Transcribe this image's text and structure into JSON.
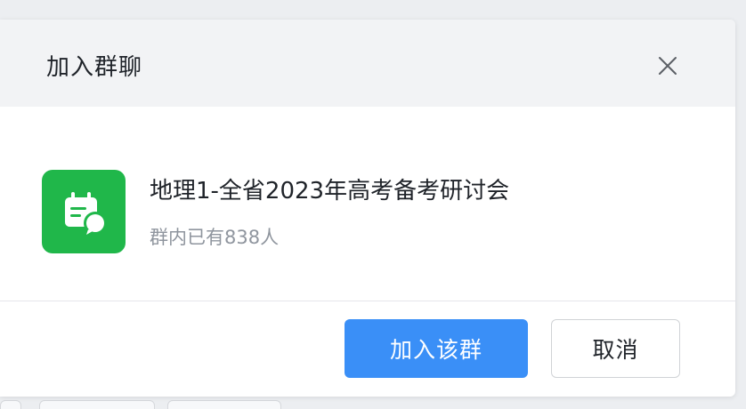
{
  "dialog": {
    "title": "加入群聊",
    "close_icon": "close-icon"
  },
  "group": {
    "avatar_icon": "calendar-chat-icon",
    "avatar_color": "#20b74a",
    "name": "地理1-全省2023年高考备考研讨会",
    "member_count_text": "群内已有838人"
  },
  "footer": {
    "join_label": "加入该群",
    "cancel_label": "取消",
    "primary_color": "#3a8ff7"
  }
}
